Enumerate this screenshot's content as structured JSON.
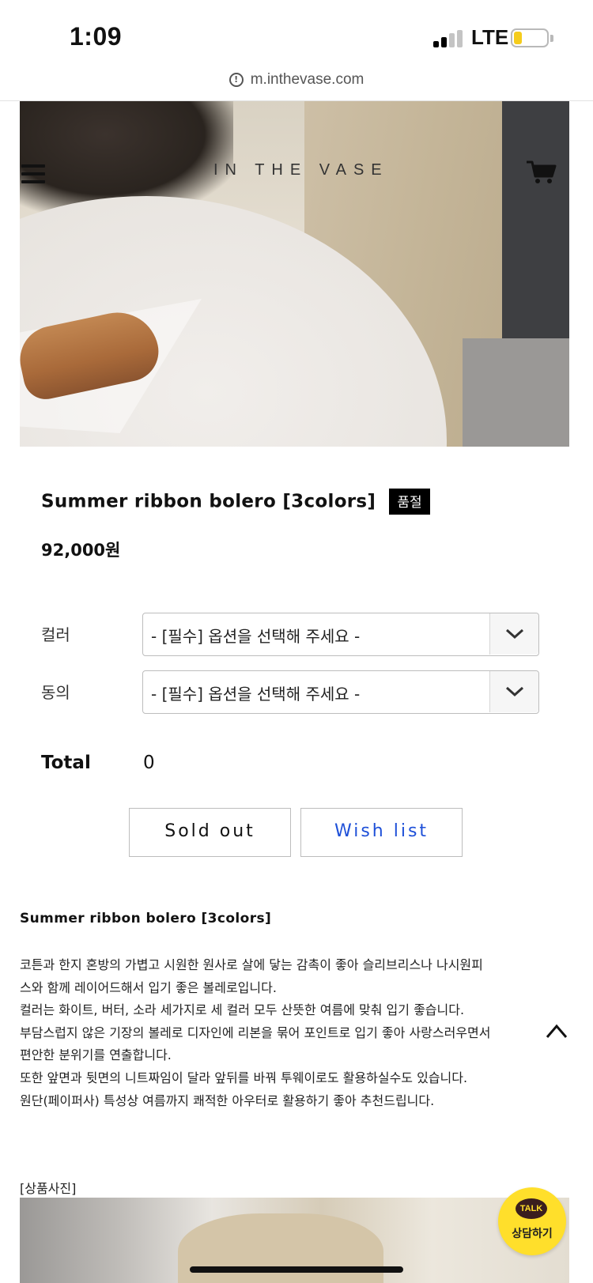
{
  "status_bar": {
    "time": "1:09",
    "network": "LTE",
    "battery_level": 0.25
  },
  "browser": {
    "url": "m.inthevase.com"
  },
  "header": {
    "logo": "IN THE VASE",
    "menu_icon": "hamburger-menu-icon",
    "cart_icon": "shopping-cart-icon"
  },
  "product": {
    "title": "Summer ribbon bolero [3colors]",
    "status_badge": "품절",
    "price": "92,000원",
    "options": [
      {
        "label": "컬러",
        "placeholder": "- [필수] 옵션을 선택해 주세요 -"
      },
      {
        "label": "동의",
        "placeholder": "- [필수] 옵션을 선택해 주세요 -"
      }
    ],
    "total_label": "Total",
    "total_value": "0",
    "buttons": {
      "sold_out": "Sold out",
      "wish_list": "Wish list"
    }
  },
  "description": {
    "title": "Summer ribbon bolero [3colors]",
    "lines": [
      "코튼과 한지 혼방의 가볍고 시원한 원사로 살에 닿는 감촉이 좋아 슬리브리스나 나시원피",
      "스와 함께 레이어드해서 입기 좋은 볼레로입니다.",
      "컬러는 화이트, 버터, 소라 세가지로 세 컬러 모두 산뜻한 여름에 맞춰 입기 좋습니다.",
      "부담스럽지 않은 기장의 볼레로 디자인에 리본을 묶어 포인트로 입기 좋아 사랑스러우면서",
      "편안한 분위기를 연출합니다.",
      "또한 앞면과 뒷면의 니트짜임이 달라 앞뒤를 바꿔 투웨이로도 활용하실수도 있습니다.",
      "원단(페이퍼사) 특성상 여름까지 쾌적한 아우터로 활용하기 좋아 추천드립니다."
    ],
    "photos_label": "[상품사진]"
  },
  "chat": {
    "badge": "TALK",
    "label": "상담하기"
  },
  "colors": {
    "wish_list_text": "#1e50d8",
    "talk_button": "#ffdf2b",
    "badge_bg": "#000000"
  }
}
